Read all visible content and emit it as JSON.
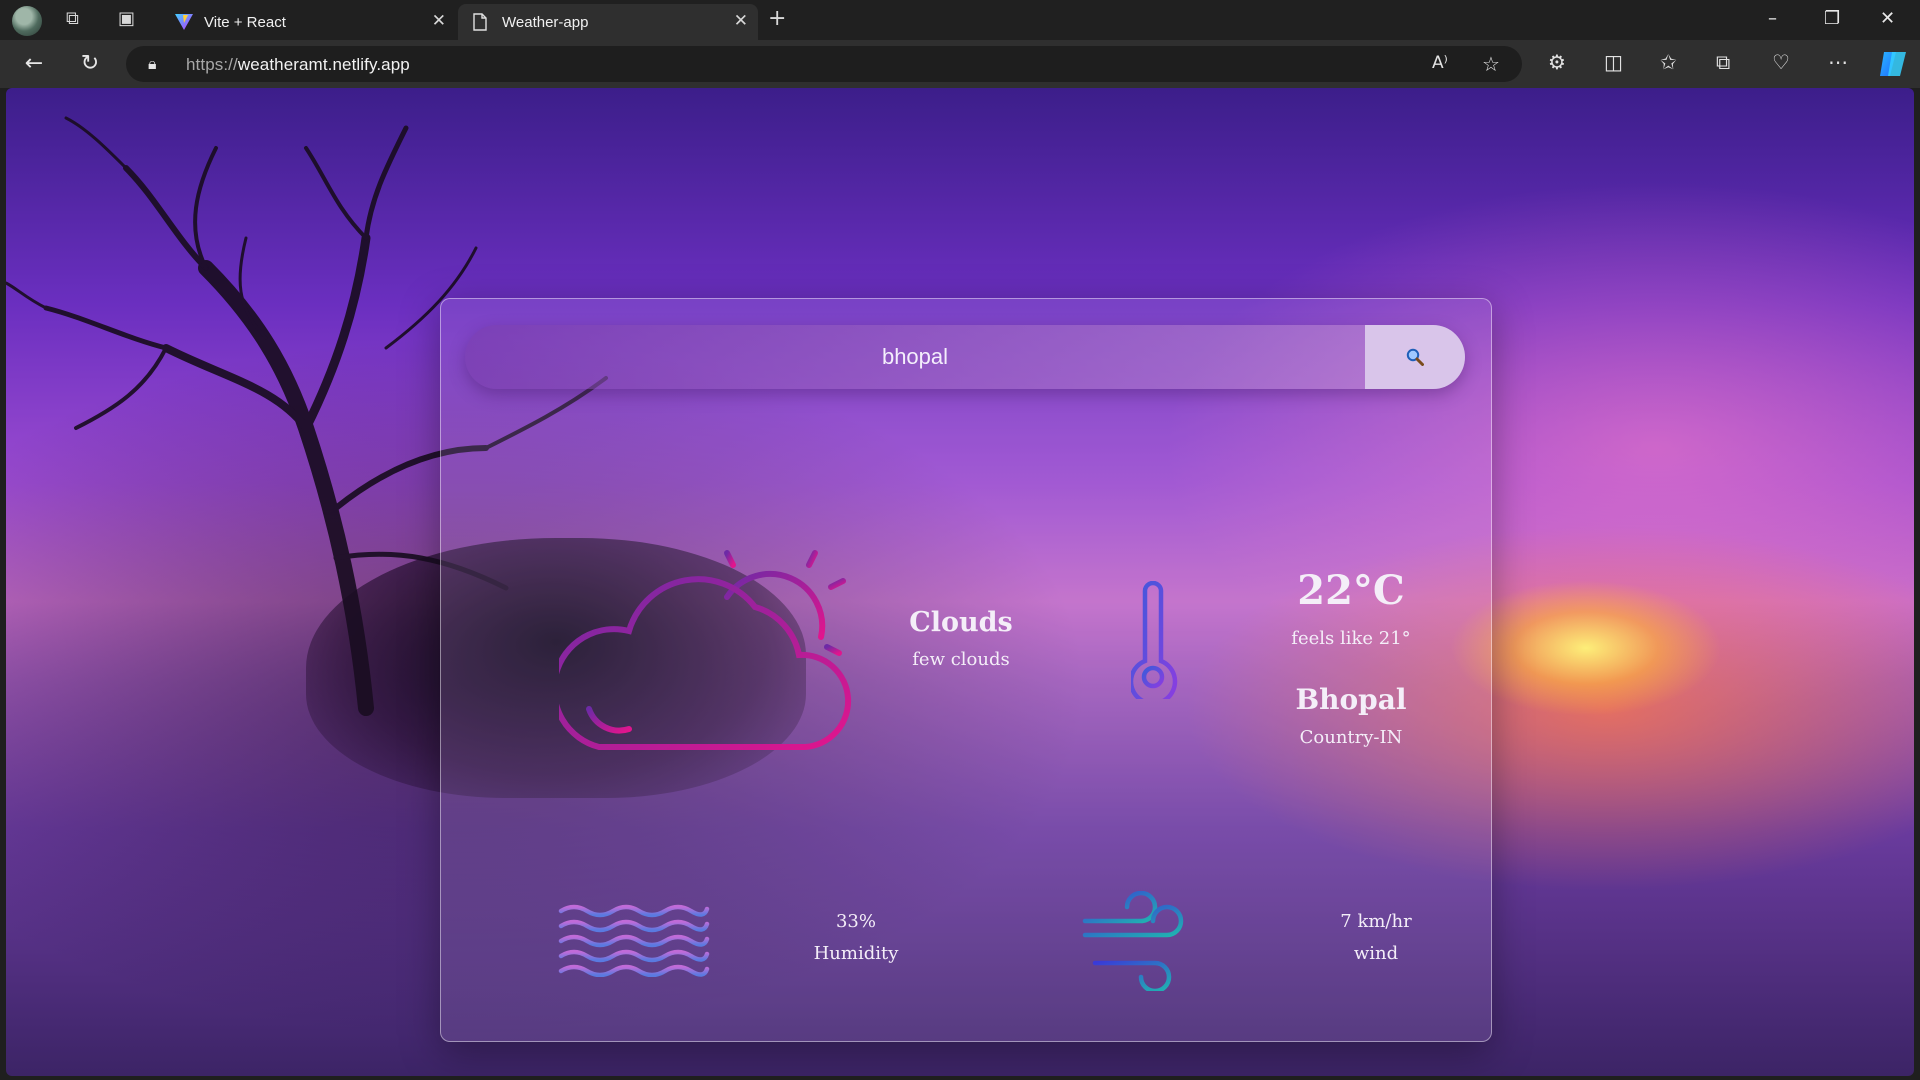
{
  "browser": {
    "tabs": [
      {
        "title": "Vite + React",
        "active": false
      },
      {
        "title": "Weather-app",
        "active": true
      }
    ],
    "url_scheme": "https://",
    "url_host": "weatheramt.netlify.app"
  },
  "search": {
    "value": "bhopal"
  },
  "weather": {
    "main": "Clouds",
    "description": "few clouds",
    "temperature": "22°C",
    "feels_like": "feels like 21°",
    "city": "Bhopal",
    "country": "Country-IN",
    "humidity_value": "33%",
    "humidity_label": "Humidity",
    "wind_value": "7 km/hr",
    "wind_label": "wind"
  },
  "colors": {
    "cloud_gradient_start": "#7a2aa8",
    "cloud_gradient_end": "#e0148f",
    "thermo_start": "#3b5bdb",
    "thermo_end": "#8a3de0",
    "wave_top": "#c06bd8",
    "wave_bottom": "#5a7ae0",
    "wind_start": "#3a3ad8",
    "wind_end": "#1fb5b0"
  }
}
